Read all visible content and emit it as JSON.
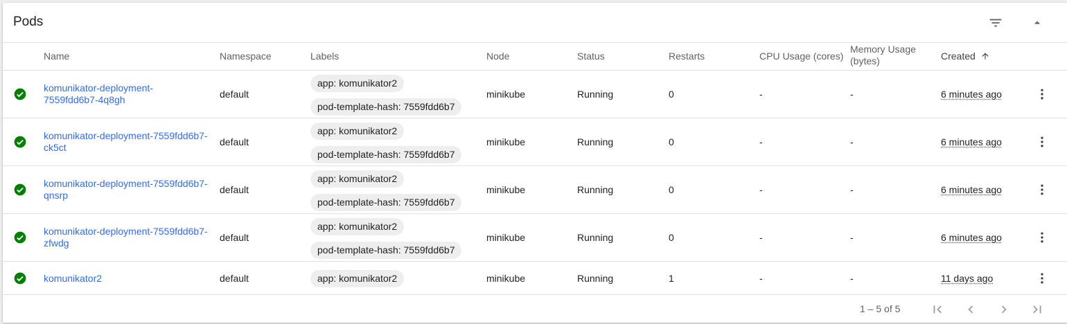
{
  "card": {
    "title": "Pods",
    "icons": {
      "filter": "filter-list-icon",
      "collapse": "arrow-drop-up-icon"
    }
  },
  "columns": {
    "name": "Name",
    "namespace": "Namespace",
    "labels": "Labels",
    "node": "Node",
    "status": "Status",
    "restarts": "Restarts",
    "cpu": "CPU Usage (cores)",
    "memory_line1": "Memory Usage",
    "memory_line2": "(bytes)",
    "created": "Created",
    "sort_icon": "arrow-upward-icon"
  },
  "rows": [
    {
      "name_line1": "komunikator-deployment-",
      "name_line2": "7559fdd6b7-4q8gh",
      "namespace": "default",
      "labels": [
        "app: komunikator2",
        "pod-template-hash: 7559fdd6b7"
      ],
      "node": "minikube",
      "status": "Running",
      "restarts": "0",
      "cpu": "-",
      "memory": "-",
      "created": "6 minutes ago"
    },
    {
      "name_line1": "komunikator-deployment-7559fdd6b7-",
      "name_line2": "ck5ct",
      "namespace": "default",
      "labels": [
        "app: komunikator2",
        "pod-template-hash: 7559fdd6b7"
      ],
      "node": "minikube",
      "status": "Running",
      "restarts": "0",
      "cpu": "-",
      "memory": "-",
      "created": "6 minutes ago"
    },
    {
      "name_line1": "komunikator-deployment-7559fdd6b7-",
      "name_line2": "qnsrp",
      "namespace": "default",
      "labels": [
        "app: komunikator2",
        "pod-template-hash: 7559fdd6b7"
      ],
      "node": "minikube",
      "status": "Running",
      "restarts": "0",
      "cpu": "-",
      "memory": "-",
      "created": "6 minutes ago"
    },
    {
      "name_line1": "komunikator-deployment-7559fdd6b7-",
      "name_line2": "zfwdg",
      "namespace": "default",
      "labels": [
        "app: komunikator2",
        "pod-template-hash: 7559fdd6b7"
      ],
      "node": "minikube",
      "status": "Running",
      "restarts": "0",
      "cpu": "-",
      "memory": "-",
      "created": "6 minutes ago"
    },
    {
      "name_line1": "komunikator2",
      "name_line2": "",
      "namespace": "default",
      "labels": [
        "app: komunikator2"
      ],
      "node": "minikube",
      "status": "Running",
      "restarts": "1",
      "cpu": "-",
      "memory": "-",
      "created": "11 days ago"
    }
  ],
  "status_icon": "check-circle-icon",
  "row_menu_icon": "more-vert-icon",
  "pagination": {
    "range": "1 – 5 of 5",
    "icons": [
      "first-page-icon",
      "chevron-left-icon",
      "chevron-right-icon",
      "last-page-icon"
    ]
  },
  "colors": {
    "link": "#326de6",
    "status_ok": "#008000",
    "chip_bg": "#eeeeee",
    "header_text": "#616161"
  }
}
